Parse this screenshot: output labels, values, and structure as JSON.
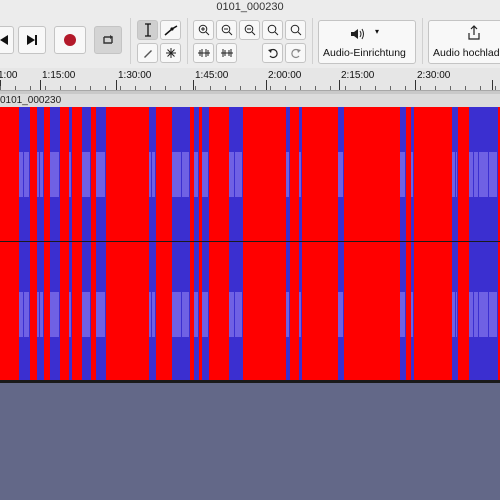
{
  "window": {
    "title": "0101_000230"
  },
  "toolbar": {
    "audio_setup_label": "Audio-Einrichtung",
    "share_label": "Audio hochlad",
    "icons": {
      "skip_end": "skip-to-end-icon",
      "record": "record-icon",
      "loop": "loop-icon",
      "select": "selection-tool-icon",
      "envelope": "envelope-tool-icon",
      "draw": "draw-tool-icon",
      "multi": "multi-tool-icon",
      "zoom_in": "zoom-in-icon",
      "zoom_out": "zoom-out-icon",
      "fit_selection": "fit-selection-icon",
      "fit_project": "fit-project-icon",
      "zoom_toggle": "zoom-toggle-icon",
      "trim": "trim-audio-icon",
      "silence": "silence-audio-icon",
      "undo": "undo-icon",
      "redo": "redo-icon",
      "speaker": "speaker-icon",
      "share": "share-icon"
    }
  },
  "timeline": {
    "labels": [
      "1:00",
      "1:15:00",
      "1:30:00",
      "1:45:00",
      "2:00:00",
      "2:15:00",
      "2:30:00"
    ]
  },
  "track": {
    "clip_name": "0101_000230"
  },
  "colors": {
    "waveform": "#ff0000",
    "spectral": "#3b2fd0",
    "spectral_light": "#7d6ee8",
    "empty_area": "#636888",
    "record": "#b3192a"
  }
}
